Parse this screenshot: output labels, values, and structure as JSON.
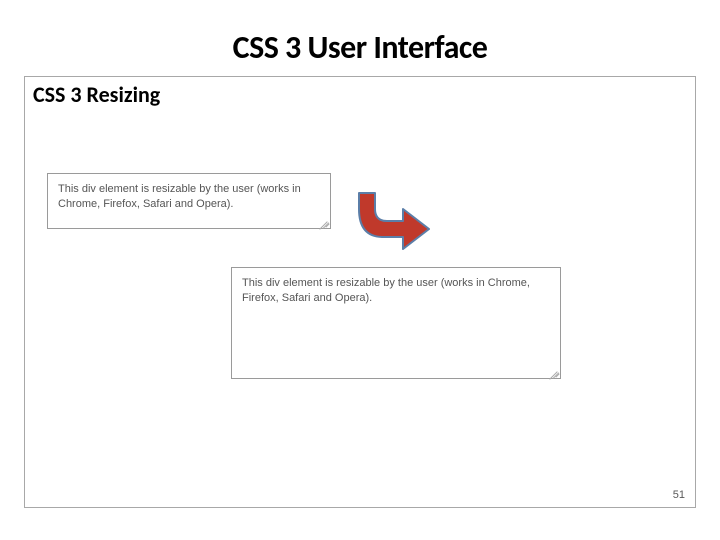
{
  "slide": {
    "title": "CSS 3 User Interface",
    "subtitle": "CSS 3 Resizing",
    "page_number": "51"
  },
  "demo": {
    "box1_text": "This div element is resizable by the user (works in Chrome, Firefox, Safari and Opera).",
    "box2_text": "This div element is resizable by the user (works in Chrome, Firefox, Safari and Opera)."
  },
  "colors": {
    "arrow_fill": "#c0392b",
    "arrow_stroke": "#5b7ea8"
  }
}
